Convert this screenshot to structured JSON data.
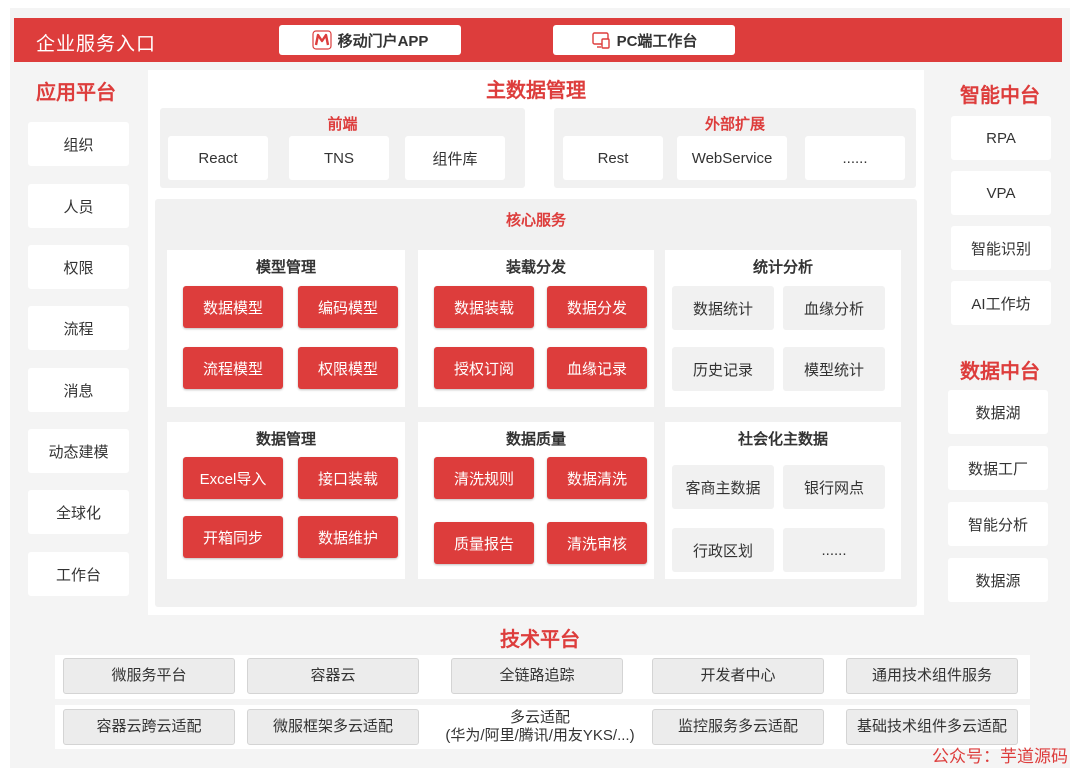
{
  "header": {
    "title": "企业服务入口",
    "buttons": [
      {
        "label": "移动门户APP",
        "icon": "m-logo-icon"
      },
      {
        "label": "PC端工作台",
        "icon": "pc-icon"
      }
    ]
  },
  "app_platform": {
    "title": "应用平台",
    "items": [
      "组织",
      "人员",
      "权限",
      "流程",
      "消息",
      "动态建模",
      "全球化",
      "工作台"
    ]
  },
  "mdm": {
    "title": "主数据管理",
    "frontend": {
      "title": "前端",
      "items": [
        "React",
        "TNS",
        "组件库"
      ]
    },
    "external": {
      "title": "外部扩展",
      "items": [
        "Rest",
        "WebService",
        "......"
      ]
    },
    "core": {
      "title": "核心服务",
      "groups": [
        {
          "title": "模型管理",
          "items": [
            "数据模型",
            "编码模型",
            "流程模型",
            "权限模型"
          ]
        },
        {
          "title": "装载分发",
          "items": [
            "数据装载",
            "数据分发",
            "授权订阅",
            "血缘记录"
          ]
        },
        {
          "title": "统计分析",
          "items": [
            "数据统计",
            "血缘分析",
            "历史记录",
            "模型统计"
          ]
        },
        {
          "title": "数据管理",
          "items": [
            "Excel导入",
            "接口装载",
            "开箱同步",
            "数据维护"
          ]
        },
        {
          "title": "数据质量",
          "items": [
            "清洗规则",
            "数据清洗",
            "质量报告",
            "清洗审核"
          ]
        },
        {
          "title": "社会化主数据",
          "items": [
            "客商主数据",
            "银行网点",
            "行政区划",
            "......"
          ]
        }
      ]
    }
  },
  "ai_platform": {
    "title": "智能中台",
    "items": [
      "RPA",
      "VPA",
      "智能识别",
      "AI工作坊"
    ]
  },
  "data_platform": {
    "title": "数据中台",
    "items": [
      "数据湖",
      "数据工厂",
      "智能分析",
      "数据源"
    ]
  },
  "tech_platform": {
    "title": "技术平台",
    "row1": [
      "微服务平台",
      "容器云",
      "全链路追踪",
      "开发者中心",
      "通用技术组件服务"
    ],
    "row2": [
      "容器云跨云适配",
      "微服框架多云适配",
      "多云适配",
      "(华为/阿里/腾讯/用友YKS/...)",
      "监控服务多云适配",
      "基础技术组件多云适配"
    ]
  },
  "watermark": "公众号：芋道源码",
  "colors": {
    "accent": "#dd3d3c",
    "panel_bg": "#f1f1f1"
  }
}
